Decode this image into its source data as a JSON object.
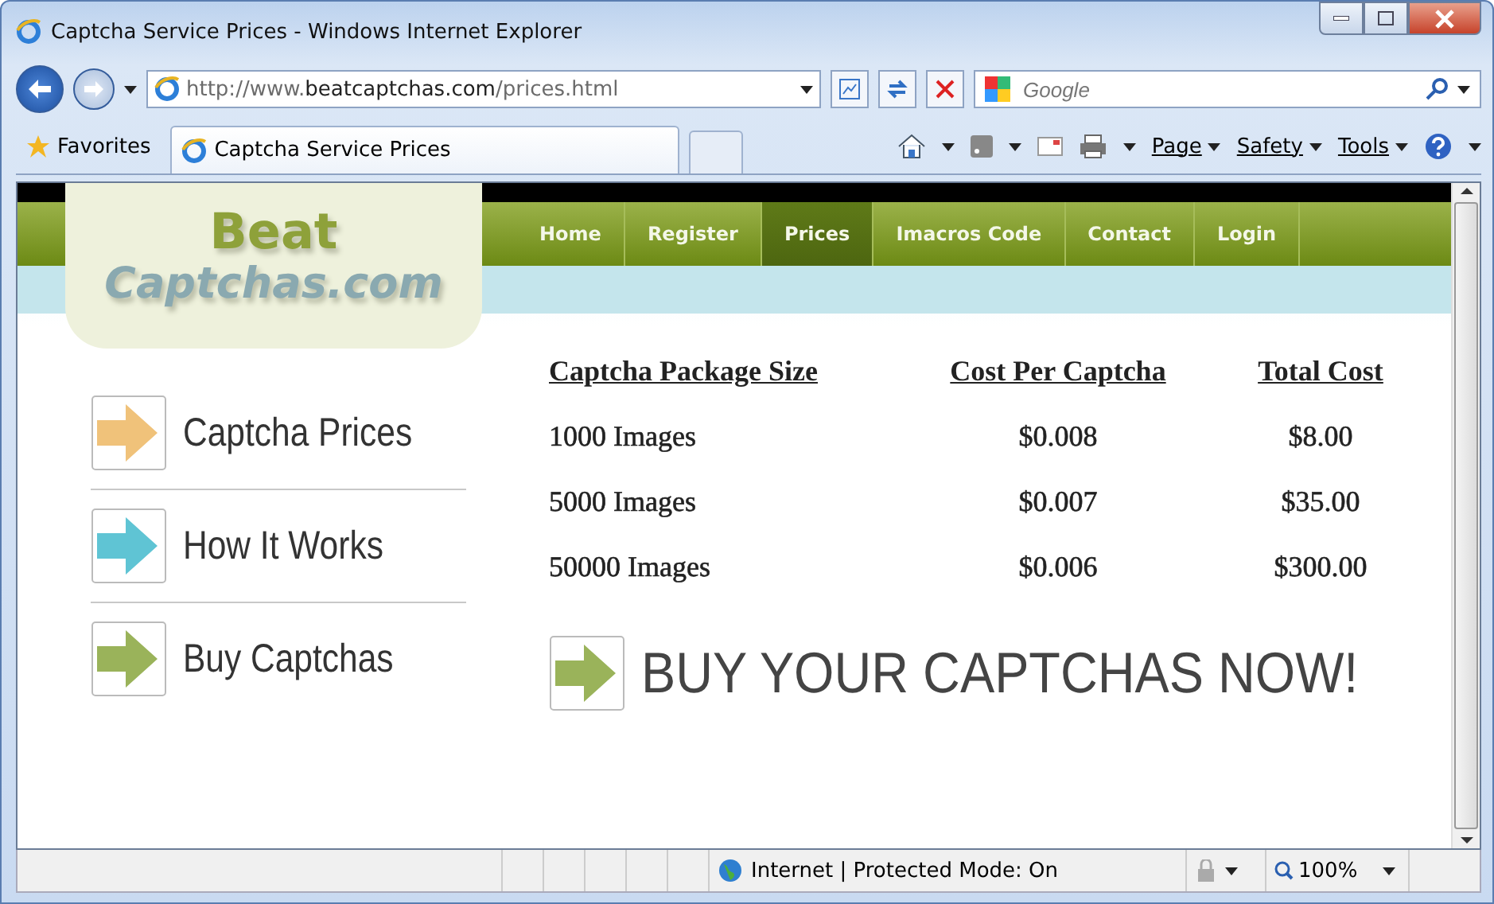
{
  "window": {
    "title": "Captcha Service Prices - Windows Internet Explorer"
  },
  "address_bar": {
    "prefix": "http://www.",
    "domain": "beatcaptchas.com",
    "path": "/prices.html"
  },
  "search": {
    "placeholder": "Google"
  },
  "favorites": {
    "label": "Favorites"
  },
  "tab": {
    "label": "Captcha Service Prices"
  },
  "command_bar": [
    "Page",
    "Safety",
    "Tools"
  ],
  "site": {
    "logo": [
      "Beat",
      "Captchas.com"
    ],
    "nav": [
      {
        "label": "Home",
        "selected": false
      },
      {
        "label": "Register",
        "selected": false
      },
      {
        "label": "Prices",
        "selected": true
      },
      {
        "label": "Imacros Code",
        "selected": false
      },
      {
        "label": "Contact",
        "selected": false
      },
      {
        "label": "Login",
        "selected": false
      }
    ],
    "sidebar": [
      {
        "label": "Captcha Prices",
        "color": "#f0c27a"
      },
      {
        "label": "How It Works",
        "color": "#5fc4d4"
      },
      {
        "label": "Buy Captchas",
        "color": "#9ab35a"
      }
    ],
    "table": {
      "columns": [
        "Captcha Package Size",
        "Cost Per Captcha",
        "Total Cost"
      ],
      "rows": [
        [
          "1000 Images",
          "$0.008",
          "$8.00"
        ],
        [
          "5000 Images",
          "$0.007",
          "$35.00"
        ],
        [
          "50000 Images",
          "$0.006",
          "$300.00"
        ]
      ]
    },
    "cta": {
      "label": "BUY YOUR CAPTCHAS NOW!",
      "color": "#9ab35a"
    }
  },
  "status_bar": {
    "zone": "Internet | Protected Mode: On",
    "zoom": "100%"
  }
}
